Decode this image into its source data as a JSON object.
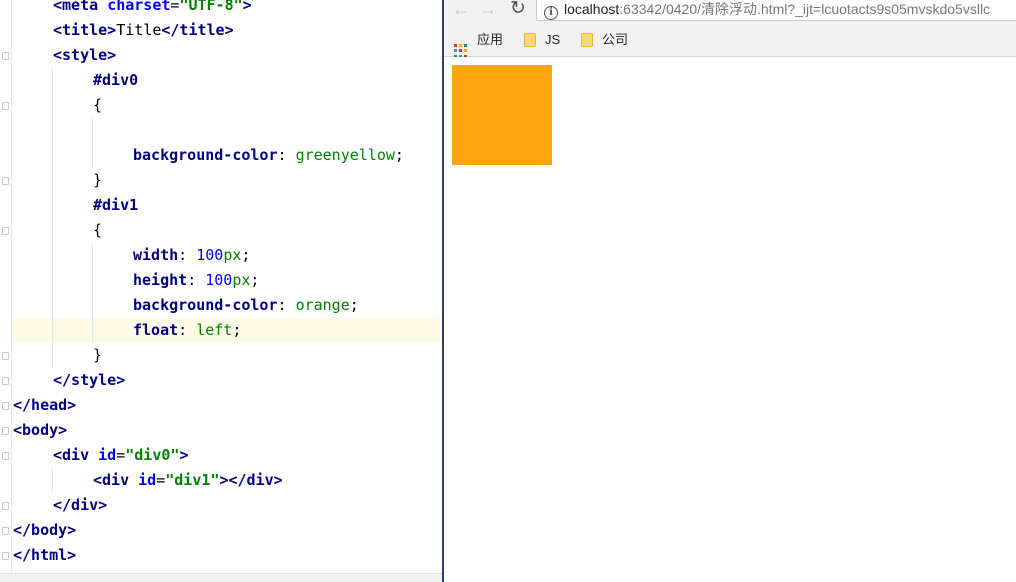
{
  "editor": {
    "lines": [
      {
        "indent": 1,
        "tokens": [
          [
            "tag",
            "<meta "
          ],
          [
            "attr",
            "charset"
          ],
          [
            "punc",
            "="
          ],
          [
            "str",
            "\"UTF-8\""
          ],
          [
            "tag",
            ">"
          ]
        ]
      },
      {
        "indent": 1,
        "tokens": [
          [
            "tag",
            "<title>"
          ],
          [
            "txt",
            "Title"
          ],
          [
            "tag",
            "</title>"
          ]
        ]
      },
      {
        "indent": 1,
        "tokens": [
          [
            "tag",
            "<style>"
          ]
        ]
      },
      {
        "indent": 2,
        "tokens": [
          [
            "sel",
            "#div0"
          ]
        ]
      },
      {
        "indent": 2,
        "tokens": [
          [
            "punc",
            "{"
          ]
        ]
      },
      {
        "indent": 3,
        "tokens": []
      },
      {
        "indent": 3,
        "tokens": [
          [
            "prop",
            "background-color"
          ],
          [
            "punc",
            ": "
          ],
          [
            "val",
            "greenyellow"
          ],
          [
            "punc",
            ";"
          ]
        ]
      },
      {
        "indent": 2,
        "tokens": [
          [
            "punc",
            "}"
          ]
        ]
      },
      {
        "indent": 2,
        "tokens": [
          [
            "sel",
            "#div1"
          ]
        ]
      },
      {
        "indent": 2,
        "tokens": [
          [
            "punc",
            "{"
          ]
        ]
      },
      {
        "indent": 3,
        "tokens": [
          [
            "prop",
            "width"
          ],
          [
            "punc",
            ": "
          ],
          [
            "num",
            "100"
          ],
          [
            "val",
            "px"
          ],
          [
            "punc",
            ";"
          ]
        ]
      },
      {
        "indent": 3,
        "tokens": [
          [
            "prop",
            "height"
          ],
          [
            "punc",
            ": "
          ],
          [
            "num",
            "100"
          ],
          [
            "val",
            "px"
          ],
          [
            "punc",
            ";"
          ]
        ]
      },
      {
        "indent": 3,
        "tokens": [
          [
            "prop",
            "background-color"
          ],
          [
            "punc",
            ": "
          ],
          [
            "val",
            "orange"
          ],
          [
            "punc",
            ";"
          ]
        ]
      },
      {
        "indent": 3,
        "current": true,
        "tokens": [
          [
            "prop",
            "float"
          ],
          [
            "punc",
            ": "
          ],
          [
            "val",
            "left"
          ],
          [
            "punc",
            ";"
          ]
        ]
      },
      {
        "indent": 2,
        "tokens": [
          [
            "punc",
            "}"
          ]
        ]
      },
      {
        "indent": 1,
        "tokens": [
          [
            "tag",
            "</style>"
          ]
        ]
      },
      {
        "indent": 0,
        "tokens": [
          [
            "tag",
            "</head>"
          ]
        ]
      },
      {
        "indent": 0,
        "tokens": [
          [
            "tag",
            "<body>"
          ]
        ]
      },
      {
        "indent": 1,
        "tokens": [
          [
            "tag",
            "<div "
          ],
          [
            "attr",
            "id"
          ],
          [
            "punc",
            "="
          ],
          [
            "str",
            "\"div0\""
          ],
          [
            "tag",
            ">"
          ]
        ]
      },
      {
        "indent": 2,
        "tokens": [
          [
            "tag",
            "<div "
          ],
          [
            "attr",
            "id"
          ],
          [
            "punc",
            "="
          ],
          [
            "str",
            "\"div1\""
          ],
          [
            "tag",
            ">"
          ],
          [
            "tag",
            "</div>"
          ]
        ]
      },
      {
        "indent": 1,
        "tokens": [
          [
            "tag",
            "</div>"
          ]
        ]
      },
      {
        "indent": 0,
        "tokens": [
          [
            "tag",
            "</body>"
          ]
        ]
      },
      {
        "indent": 0,
        "tokens": [
          [
            "tag",
            "</html>"
          ]
        ]
      }
    ]
  },
  "browser": {
    "back_icon": "back-arrow-icon",
    "forward_icon": "forward-arrow-icon",
    "reload_icon": "reload-icon",
    "url_host": "localhost",
    "url_path": ":63342/0420/清除浮动.html?_ijt=lcuotacts9s05mvskdo5vsllc",
    "bookmarks": [
      {
        "label": "应用",
        "icon": "apps-grid-icon"
      },
      {
        "label": "JS",
        "icon": "folder-icon"
      },
      {
        "label": "公司",
        "icon": "folder-icon"
      }
    ],
    "page": {
      "div1_color": "#ffa510"
    }
  },
  "colors": {
    "divider": "#2f3f6a",
    "current_line": "#fefbe6"
  }
}
